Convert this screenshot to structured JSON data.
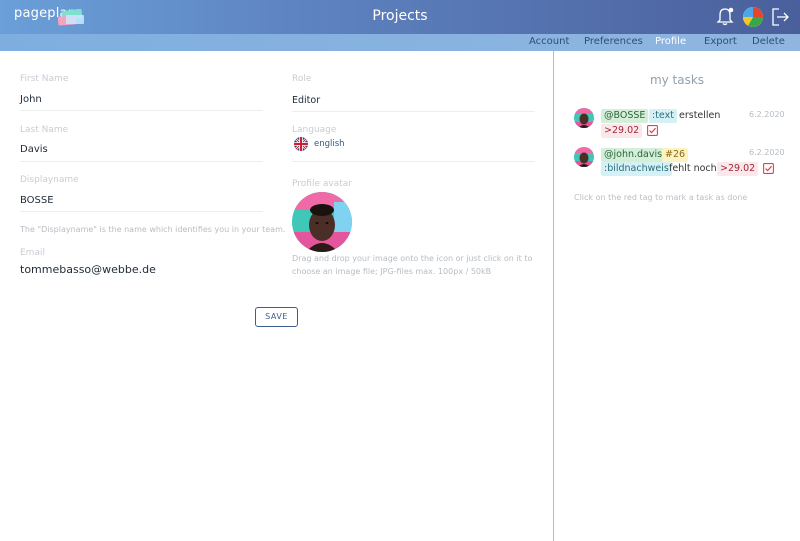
{
  "header": {
    "logo_text": "pageplanr",
    "title": "Projects",
    "icons": [
      "bell-icon",
      "user-avatar",
      "logout-icon"
    ]
  },
  "subnav": {
    "items": [
      {
        "label": "Account",
        "active": false
      },
      {
        "label": "Preferences",
        "active": false
      },
      {
        "label": "Profile",
        "active": true
      },
      {
        "label": "Export",
        "active": false
      },
      {
        "label": "Delete",
        "active": false
      }
    ]
  },
  "profile": {
    "first_name": {
      "label": "First Name",
      "value": "John"
    },
    "last_name": {
      "label": "Last Name",
      "value": "Davis"
    },
    "displayname": {
      "label": "Displayname",
      "value": "BOSSE",
      "hint": "The \"Displayname\" is the name which identifies you in your team."
    },
    "email": {
      "label": "Email",
      "value": "tommebasso@webbe.de"
    },
    "role": {
      "label": "Role",
      "value": "Editor"
    },
    "language": {
      "label": "Language",
      "value": "english",
      "flag": "uk-flag-icon"
    },
    "avatar": {
      "label": "Profile avatar",
      "hint_line1": "Drag and drop your image onto the icon or just click on it to",
      "hint_line2": "choose an image file; JPG-files max. 100px / 50kB"
    },
    "save_label": "SAVE"
  },
  "tasks": {
    "title": "my tasks",
    "items": [
      {
        "date": "6.2.2020",
        "tag_user": "@BOSSE",
        "tag_object": ":text",
        "text": "erstellen",
        "due": ">29.02"
      },
      {
        "date": "6.2.2020",
        "tag_user": "@john.davis",
        "tag_ref": "#26",
        "tag_object": ":bildnachweis",
        "text": "fehlt noch!",
        "due": ">29.02"
      }
    ],
    "hint": "Click on the red tag to mark a task as done"
  },
  "colors": {
    "header_gradient_start": "#6a9fd8",
    "header_gradient_end": "#4a5f9c",
    "subnav": "#8ab2de",
    "accent": "#3d5f90",
    "tag_green": "#d3efd9",
    "tag_cyan": "#d6f1f5",
    "tag_red": "#fbe8ea",
    "tag_yellow": "#fdf3c2"
  }
}
